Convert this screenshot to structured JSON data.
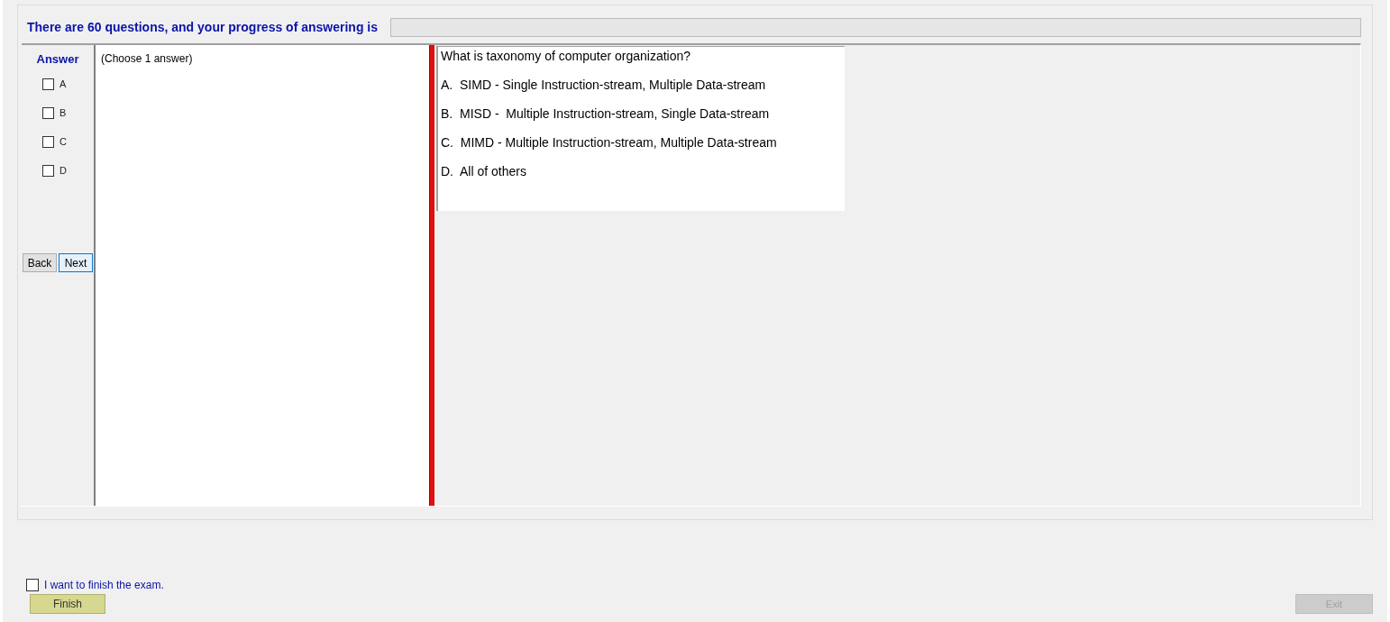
{
  "header": {
    "text": "There are 60 questions, and your progress of answering is",
    "progress": {
      "level": 0
    }
  },
  "answer": {
    "title": "Answer",
    "options": [
      {
        "label": "A",
        "checked": false
      },
      {
        "label": "B",
        "checked": false
      },
      {
        "label": "C",
        "checked": false
      },
      {
        "label": "D",
        "checked": false
      }
    ]
  },
  "nav": [
    {
      "label": "Back",
      "focused": false
    },
    {
      "label": "Next",
      "focused": true
    }
  ],
  "instruction": "(Choose 1 answer)",
  "question": {
    "text": "What is taxonomy of computer organization?",
    "options": [
      "A.  SIMD - Single Instruction-stream, Multiple Data-stream",
      "B.  MISD -  Multiple Instruction-stream, Single Data-stream",
      "C.  MIMD - Multiple Instruction-stream, Multiple Data-stream",
      "D.  All of others"
    ]
  },
  "finish": {
    "confirm": {
      "label": "I want to finish the exam.",
      "checked": false
    },
    "button": {
      "label": "Finish",
      "disabled": false
    }
  },
  "exit": {
    "label": "Exit",
    "disabled": true
  }
}
